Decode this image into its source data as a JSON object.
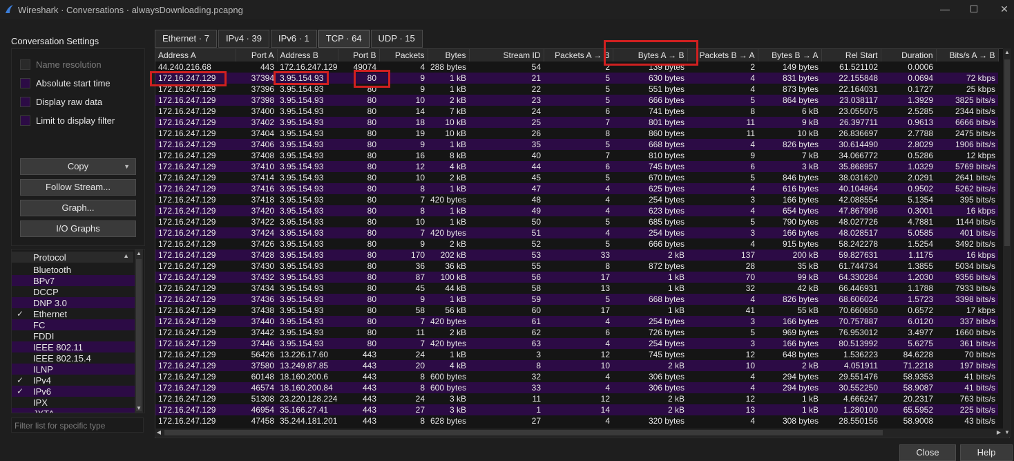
{
  "window": {
    "title": "Wireshark · Conversations · alwaysDownloading.pcapng"
  },
  "settings": {
    "title": "Conversation Settings",
    "options": [
      {
        "label": "Name resolution",
        "checked": false,
        "disabled": true
      },
      {
        "label": "Absolute start time",
        "checked": false,
        "disabled": false
      },
      {
        "label": "Display raw data",
        "checked": false,
        "disabled": false
      },
      {
        "label": "Limit to display filter",
        "checked": false,
        "disabled": false
      }
    ],
    "buttons": {
      "copy": "Copy",
      "follow": "Follow Stream...",
      "graph": "Graph...",
      "io": "I/O Graphs"
    }
  },
  "protocol_list": {
    "header": "Protocol",
    "items": [
      {
        "name": "Bluetooth",
        "checked": false
      },
      {
        "name": "BPv7",
        "checked": false
      },
      {
        "name": "DCCP",
        "checked": false
      },
      {
        "name": "DNP 3.0",
        "checked": false
      },
      {
        "name": "Ethernet",
        "checked": true
      },
      {
        "name": "FC",
        "checked": false
      },
      {
        "name": "FDDI",
        "checked": false
      },
      {
        "name": "IEEE 802.11",
        "checked": false
      },
      {
        "name": "IEEE 802.15.4",
        "checked": false
      },
      {
        "name": "ILNP",
        "checked": false
      },
      {
        "name": "IPv4",
        "checked": true
      },
      {
        "name": "IPv6",
        "checked": true
      },
      {
        "name": "IPX",
        "checked": false
      },
      {
        "name": "JXTA",
        "checked": false
      }
    ],
    "filter_placeholder": "Filter list for specific type"
  },
  "tabs": [
    {
      "label": "Ethernet · 7",
      "active": false
    },
    {
      "label": "IPv4 · 39",
      "active": false
    },
    {
      "label": "IPv6 · 1",
      "active": false
    },
    {
      "label": "TCP · 64",
      "active": true
    },
    {
      "label": "UDP · 15",
      "active": false
    }
  ],
  "table": {
    "columns": [
      "Address A",
      "Port A",
      "Address B",
      "Port B",
      "Packets",
      "Bytes",
      "Stream ID",
      "Packets A → B",
      "Bytes A → B",
      "Packets B → A",
      "Bytes B → A",
      "Rel Start",
      "Duration",
      "Bits/s A → B"
    ],
    "rows": [
      [
        "44.240.216.68",
        "443",
        "172.16.247.129",
        "49074",
        "4",
        "288 bytes",
        "54",
        "2",
        "139 bytes",
        "2",
        "149 bytes",
        "61.521102",
        "0.0006",
        ""
      ],
      [
        "172.16.247.129",
        "37394",
        "3.95.154.93",
        "80",
        "9",
        "1 kB",
        "21",
        "5",
        "630 bytes",
        "4",
        "831 bytes",
        "22.155848",
        "0.0694",
        "72 kbps"
      ],
      [
        "172.16.247.129",
        "37396",
        "3.95.154.93",
        "80",
        "9",
        "1 kB",
        "22",
        "5",
        "551 bytes",
        "4",
        "873 bytes",
        "22.164031",
        "0.1727",
        "25 kbps"
      ],
      [
        "172.16.247.129",
        "37398",
        "3.95.154.93",
        "80",
        "10",
        "2 kB",
        "23",
        "5",
        "666 bytes",
        "5",
        "864 bytes",
        "23.038117",
        "1.3929",
        "3825 bits/s"
      ],
      [
        "172.16.247.129",
        "37400",
        "3.95.154.93",
        "80",
        "14",
        "7 kB",
        "24",
        "6",
        "741 bytes",
        "8",
        "6 kB",
        "23.055075",
        "2.5285",
        "2344 bits/s"
      ],
      [
        "172.16.247.129",
        "37402",
        "3.95.154.93",
        "80",
        "18",
        "10 kB",
        "25",
        "7",
        "801 bytes",
        "11",
        "9 kB",
        "26.397711",
        "0.9613",
        "6666 bits/s"
      ],
      [
        "172.16.247.129",
        "37404",
        "3.95.154.93",
        "80",
        "19",
        "10 kB",
        "26",
        "8",
        "860 bytes",
        "11",
        "10 kB",
        "26.836697",
        "2.7788",
        "2475 bits/s"
      ],
      [
        "172.16.247.129",
        "37406",
        "3.95.154.93",
        "80",
        "9",
        "1 kB",
        "35",
        "5",
        "668 bytes",
        "4",
        "826 bytes",
        "30.614490",
        "2.8029",
        "1906 bits/s"
      ],
      [
        "172.16.247.129",
        "37408",
        "3.95.154.93",
        "80",
        "16",
        "8 kB",
        "40",
        "7",
        "810 bytes",
        "9",
        "7 kB",
        "34.066772",
        "0.5286",
        "12 kbps"
      ],
      [
        "172.16.247.129",
        "37410",
        "3.95.154.93",
        "80",
        "12",
        "4 kB",
        "44",
        "6",
        "745 bytes",
        "6",
        "3 kB",
        "35.868957",
        "1.0329",
        "5769 bits/s"
      ],
      [
        "172.16.247.129",
        "37414",
        "3.95.154.93",
        "80",
        "10",
        "2 kB",
        "45",
        "5",
        "670 bytes",
        "5",
        "846 bytes",
        "38.031620",
        "2.0291",
        "2641 bits/s"
      ],
      [
        "172.16.247.129",
        "37416",
        "3.95.154.93",
        "80",
        "8",
        "1 kB",
        "47",
        "4",
        "625 bytes",
        "4",
        "616 bytes",
        "40.104864",
        "0.9502",
        "5262 bits/s"
      ],
      [
        "172.16.247.129",
        "37418",
        "3.95.154.93",
        "80",
        "7",
        "420 bytes",
        "48",
        "4",
        "254 bytes",
        "3",
        "166 bytes",
        "42.088554",
        "5.1354",
        "395 bits/s"
      ],
      [
        "172.16.247.129",
        "37420",
        "3.95.154.93",
        "80",
        "8",
        "1 kB",
        "49",
        "4",
        "623 bytes",
        "4",
        "654 bytes",
        "47.867996",
        "0.3001",
        "16 kbps"
      ],
      [
        "172.16.247.129",
        "37422",
        "3.95.154.93",
        "80",
        "10",
        "1 kB",
        "50",
        "5",
        "685 bytes",
        "5",
        "790 bytes",
        "48.027726",
        "4.7881",
        "1144 bits/s"
      ],
      [
        "172.16.247.129",
        "37424",
        "3.95.154.93",
        "80",
        "7",
        "420 bytes",
        "51",
        "4",
        "254 bytes",
        "3",
        "166 bytes",
        "48.028517",
        "5.0585",
        "401 bits/s"
      ],
      [
        "172.16.247.129",
        "37426",
        "3.95.154.93",
        "80",
        "9",
        "2 kB",
        "52",
        "5",
        "666 bytes",
        "4",
        "915 bytes",
        "58.242278",
        "1.5254",
        "3492 bits/s"
      ],
      [
        "172.16.247.129",
        "37428",
        "3.95.154.93",
        "80",
        "170",
        "202 kB",
        "53",
        "33",
        "2 kB",
        "137",
        "200 kB",
        "59.827631",
        "1.1175",
        "16 kbps"
      ],
      [
        "172.16.247.129",
        "37430",
        "3.95.154.93",
        "80",
        "36",
        "36 kB",
        "55",
        "8",
        "872 bytes",
        "28",
        "35 kB",
        "61.744734",
        "1.3855",
        "5034 bits/s"
      ],
      [
        "172.16.247.129",
        "37432",
        "3.95.154.93",
        "80",
        "87",
        "100 kB",
        "56",
        "17",
        "1 kB",
        "70",
        "99 kB",
        "64.330284",
        "1.2030",
        "9356 bits/s"
      ],
      [
        "172.16.247.129",
        "37434",
        "3.95.154.93",
        "80",
        "45",
        "44 kB",
        "58",
        "13",
        "1 kB",
        "32",
        "42 kB",
        "66.446931",
        "1.1788",
        "7933 bits/s"
      ],
      [
        "172.16.247.129",
        "37436",
        "3.95.154.93",
        "80",
        "9",
        "1 kB",
        "59",
        "5",
        "668 bytes",
        "4",
        "826 bytes",
        "68.606024",
        "1.5723",
        "3398 bits/s"
      ],
      [
        "172.16.247.129",
        "37438",
        "3.95.154.93",
        "80",
        "58",
        "56 kB",
        "60",
        "17",
        "1 kB",
        "41",
        "55 kB",
        "70.660650",
        "0.6572",
        "17 kbps"
      ],
      [
        "172.16.247.129",
        "37440",
        "3.95.154.93",
        "80",
        "7",
        "420 bytes",
        "61",
        "4",
        "254 bytes",
        "3",
        "166 bytes",
        "70.757887",
        "6.0120",
        "337 bits/s"
      ],
      [
        "172.16.247.129",
        "37442",
        "3.95.154.93",
        "80",
        "11",
        "2 kB",
        "62",
        "6",
        "726 bytes",
        "5",
        "969 bytes",
        "76.953012",
        "3.4977",
        "1660 bits/s"
      ],
      [
        "172.16.247.129",
        "37446",
        "3.95.154.93",
        "80",
        "7",
        "420 bytes",
        "63",
        "4",
        "254 bytes",
        "3",
        "166 bytes",
        "80.513992",
        "5.6275",
        "361 bits/s"
      ],
      [
        "172.16.247.129",
        "56426",
        "13.226.17.60",
        "443",
        "24",
        "1 kB",
        "3",
        "12",
        "745 bytes",
        "12",
        "648 bytes",
        "1.536223",
        "84.6228",
        "70 bits/s"
      ],
      [
        "172.16.247.129",
        "37580",
        "13.249.87.85",
        "443",
        "20",
        "4 kB",
        "8",
        "10",
        "2 kB",
        "10",
        "2 kB",
        "4.051911",
        "71.2218",
        "197 bits/s"
      ],
      [
        "172.16.247.129",
        "60148",
        "18.160.200.6",
        "443",
        "8",
        "600 bytes",
        "32",
        "4",
        "306 bytes",
        "4",
        "294 bytes",
        "29.551476",
        "58.9353",
        "41 bits/s"
      ],
      [
        "172.16.247.129",
        "46574",
        "18.160.200.84",
        "443",
        "8",
        "600 bytes",
        "33",
        "4",
        "306 bytes",
        "4",
        "294 bytes",
        "30.552250",
        "58.9087",
        "41 bits/s"
      ],
      [
        "172.16.247.129",
        "51308",
        "23.220.128.224",
        "443",
        "24",
        "3 kB",
        "11",
        "12",
        "2 kB",
        "12",
        "1 kB",
        "4.666247",
        "20.2317",
        "763 bits/s"
      ],
      [
        "172.16.247.129",
        "46954",
        "35.166.27.41",
        "443",
        "27",
        "3 kB",
        "1",
        "14",
        "2 kB",
        "13",
        "1 kB",
        "1.280100",
        "65.5952",
        "225 bits/s"
      ],
      [
        "172.16.247.129",
        "47458",
        "35.244.181.201",
        "443",
        "8",
        "628 bytes",
        "27",
        "4",
        "320 bytes",
        "4",
        "308 bytes",
        "28.550156",
        "58.9008",
        "43 bits/s"
      ]
    ]
  },
  "dialog_buttons": {
    "close": "Close",
    "help": "Help"
  },
  "colors": {
    "row_alt": "#2c0b45",
    "highlight": "#d02020",
    "background": "#1e1e1e"
  }
}
